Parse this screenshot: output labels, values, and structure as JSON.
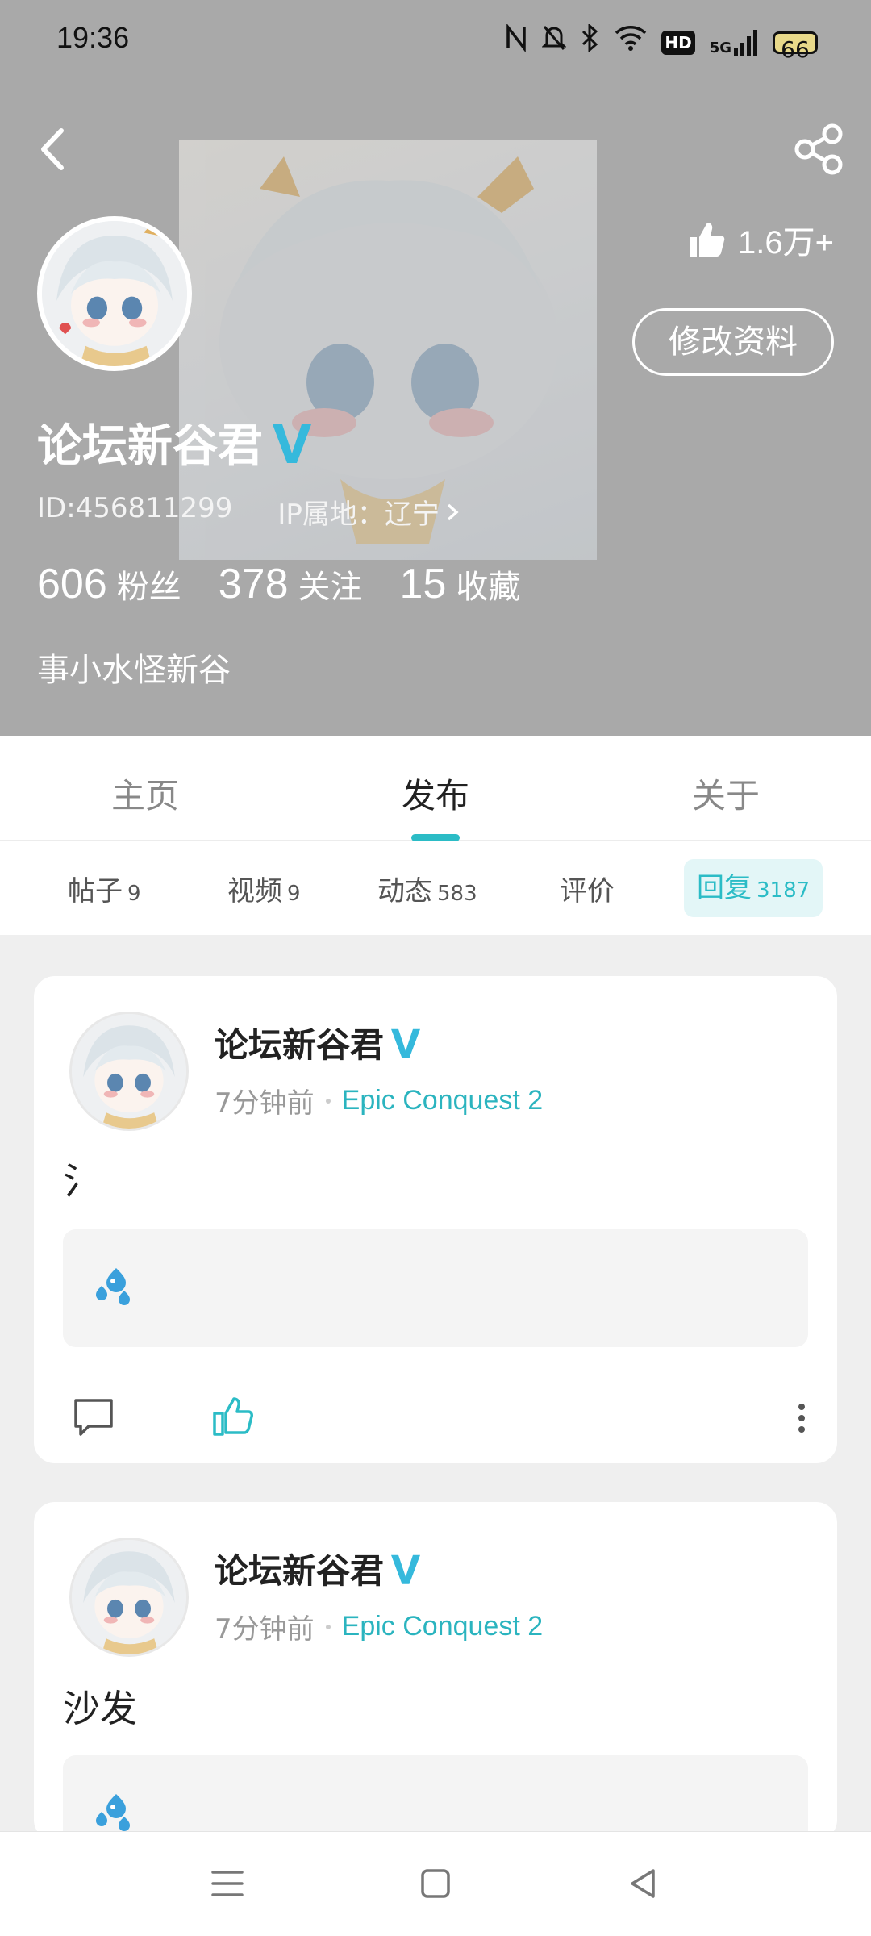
{
  "status_bar": {
    "time": "19:36",
    "icons": [
      "nfc-icon",
      "mute-icon",
      "bluetooth-icon",
      "wifi-icon",
      "hd-icon",
      "5g-signal-icon"
    ],
    "hd_label": "HD",
    "network_label": "5G",
    "battery": "66"
  },
  "profile": {
    "name": "论坛新谷君",
    "id_text": "ID:456811299",
    "ip_text": "IP属地：辽宁",
    "likes": "1.6万+",
    "edit_label": "修改资料",
    "stats": [
      {
        "num": "606",
        "label": "粉丝"
      },
      {
        "num": "378",
        "label": "关注"
      },
      {
        "num": "15",
        "label": "收藏"
      }
    ],
    "bio": "事小水怪新谷"
  },
  "tabs": [
    {
      "label": "主页"
    },
    {
      "label": "发布"
    },
    {
      "label": "关于"
    }
  ],
  "active_tab": "发布",
  "subtabs": [
    {
      "label": "帖子",
      "count": "9"
    },
    {
      "label": "视频",
      "count": "9"
    },
    {
      "label": "动态",
      "count": "583"
    },
    {
      "label": "评价",
      "count": ""
    },
    {
      "label": "回复",
      "count": "3187"
    }
  ],
  "active_subtab": "回复",
  "posts": [
    {
      "author": "论坛新谷君",
      "time": "7分钟前",
      "game": "Epic Conquest 2",
      "text": "氵"
    },
    {
      "author": "论坛新谷君",
      "time": "7分钟前",
      "game": "Epic Conquest 2",
      "text": "沙发"
    }
  ],
  "colors": {
    "accent": "#2bbcc6",
    "header_bg": "#a9a9a9",
    "verified": "#35b9dc",
    "water_drops": "#3aa0dc"
  }
}
